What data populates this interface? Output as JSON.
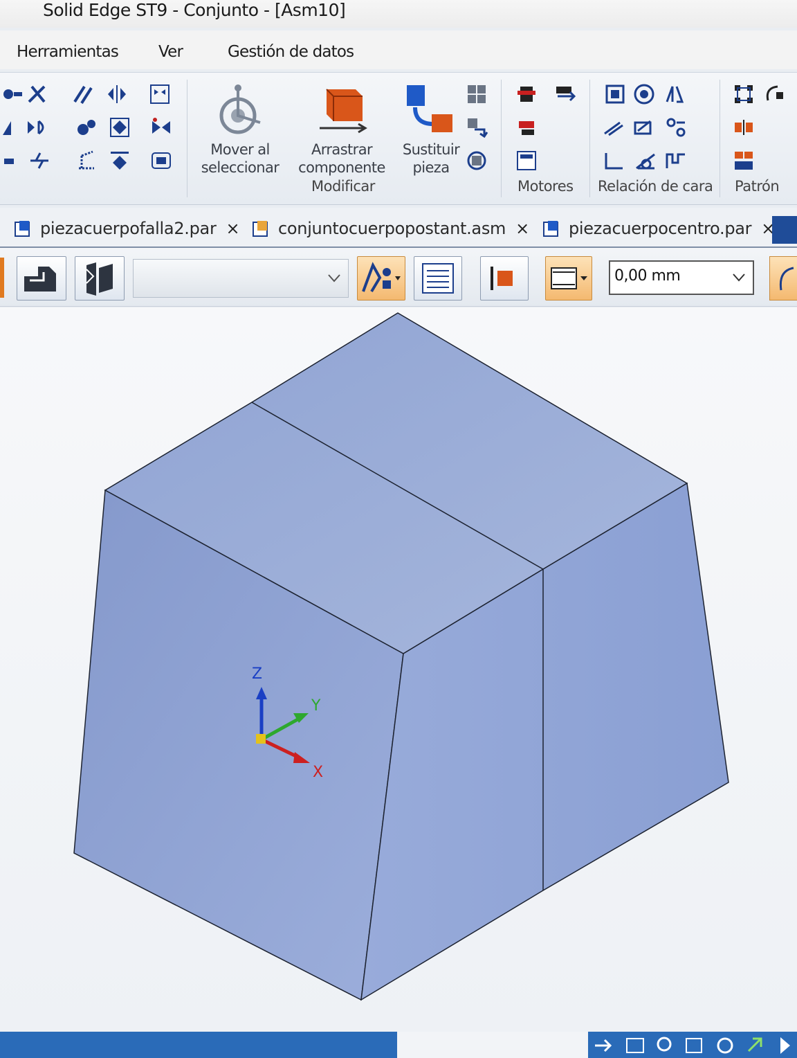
{
  "window": {
    "title": "Solid Edge ST9 - Conjunto - [Asm10]"
  },
  "menu": {
    "items": [
      "Herramientas",
      "Ver",
      "Gestión de datos"
    ]
  },
  "ribbon": {
    "buttons": {
      "move_to_select": [
        "Mover al",
        "seleccionar"
      ],
      "drag_component": [
        "Arrastrar",
        "componente"
      ],
      "replace_part": [
        "Sustituir",
        "pieza"
      ]
    },
    "groups": [
      "Modificar",
      "Motores",
      "Relación de cara",
      "Patrón"
    ]
  },
  "doc_tabs": [
    {
      "label": "piezacuerpofalla2.par",
      "close": "×"
    },
    {
      "label": "conjuntocuerpopostant.asm",
      "close": "×"
    },
    {
      "label": "piezacuerpocentro.par",
      "close": "×"
    }
  ],
  "command_bar": {
    "offset_value": "0,00 mm",
    "dropdown_value": ""
  },
  "viewport": {
    "triad": {
      "x": "X",
      "y": "Y",
      "z": "Z"
    },
    "colors": {
      "face_top": "#9fb0d6",
      "face_left": "#8ea3d0",
      "face_right": "#8fa4d4",
      "edge": "#1c2230"
    }
  },
  "status": {
    "icons": [
      "arrow-icon",
      "fit-icon",
      "zoom-icon",
      "window-icon",
      "rotate-icon",
      "pan-icon",
      "view-icon"
    ]
  }
}
